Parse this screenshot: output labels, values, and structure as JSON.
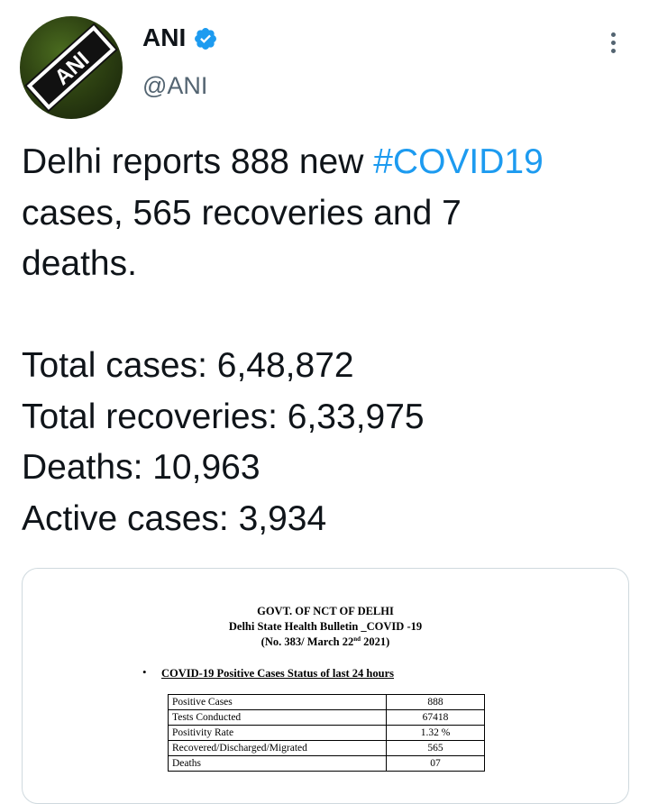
{
  "author": {
    "name": "ANI",
    "handle": "@ANI",
    "logo_text": "ANI"
  },
  "tweet": {
    "line1_pre": "Delhi reports 888 new ",
    "hashtag": "#COVID19",
    "line1_post": "\ncases, 565 recoveries and 7\ndeaths.\n\n",
    "stats": [
      "Total cases: 6,48,872",
      "Total recoveries: 6,33,975",
      "Deaths: 10,963",
      "Active cases: 3,934"
    ]
  },
  "media": {
    "title1": "GOVT. OF NCT OF DELHI",
    "title2": "Delhi State Health Bulletin _COVID -19",
    "title3_pre": "(No. 383/ March 22",
    "title3_sup": "nd",
    "title3_post": "  2021)",
    "bullet": "•",
    "section": "COVID-19 Positive Cases Status of last 24 hours",
    "rows": [
      {
        "label": "Positive Cases",
        "value": "888"
      },
      {
        "label": "Tests Conducted",
        "value": "67418"
      },
      {
        "label": "Positivity Rate",
        "value": "1.32 %"
      },
      {
        "label": "Recovered/Discharged/Migrated",
        "value": "565"
      },
      {
        "label": "Deaths",
        "value": "07"
      }
    ]
  },
  "colors": {
    "link": "#1d9bf0",
    "verified": "#1d9bf0",
    "secondary_text": "#536471"
  },
  "icons": {
    "verified": "verified-badge-icon",
    "more": "more-vertical-icon"
  }
}
